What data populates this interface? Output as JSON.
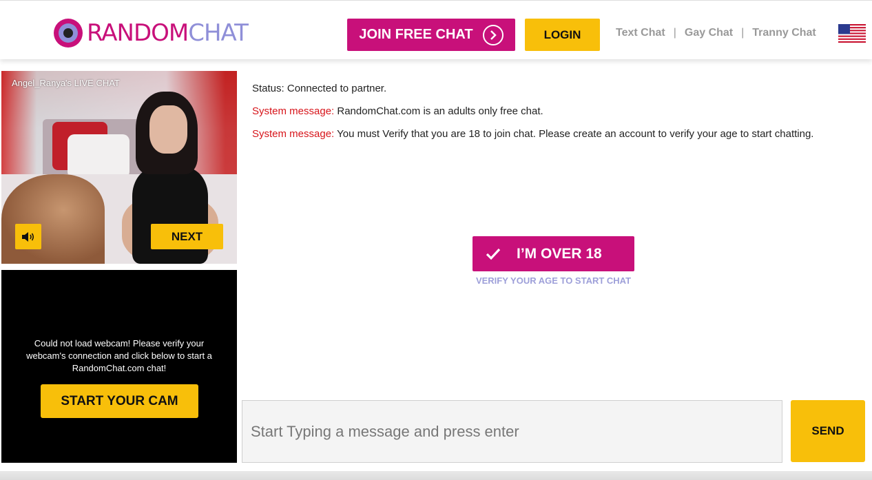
{
  "header": {
    "logo": {
      "part1": "RANDOM",
      "part2": "CHAT",
      "icon": "eye-logo-icon"
    },
    "join_button": {
      "label": "JOIN FREE CHAT",
      "icon": "chevron-right-circle-icon"
    },
    "login_button": {
      "label": "LOGIN"
    },
    "nav_links": [
      {
        "label": "Text Chat"
      },
      {
        "label": "Gay Chat"
      },
      {
        "label": "Tranny Chat"
      }
    ],
    "separator": "|",
    "language_flag": {
      "icon": "us-flag-icon"
    }
  },
  "video": {
    "title": "Angel_Ranya's LIVE CHAT",
    "mute_button": {
      "icon": "speaker-icon"
    },
    "next_button": {
      "label": "NEXT"
    }
  },
  "webcam": {
    "message": "Could not load webcam! Please verify your webcam's connection and click below to start a RandomChat.com chat!",
    "start_button": {
      "label": "START YOUR CAM"
    }
  },
  "chat": {
    "status": "Status: Connected to partner.",
    "system_messages": [
      {
        "prefix": "System message:",
        "text": " RandomChat.com is an adults only free chat."
      },
      {
        "prefix": "System message:",
        "text": " You must Verify that you are 18 to join chat. Please create an account to verify your age to start chatting."
      }
    ],
    "age_button": {
      "label": "I’M OVER 18",
      "icon": "checkmark-icon"
    },
    "age_note": "VERIFY YOUR AGE TO START CHAT",
    "input": {
      "placeholder": "Start Typing a message and press enter",
      "value": ""
    },
    "send_button": {
      "label": "SEND"
    }
  },
  "colors": {
    "brand_pink": "#c8107a",
    "brand_lavender": "#8f8fd8",
    "accent_yellow": "#f8bf0a",
    "system_red": "#d7141a"
  }
}
